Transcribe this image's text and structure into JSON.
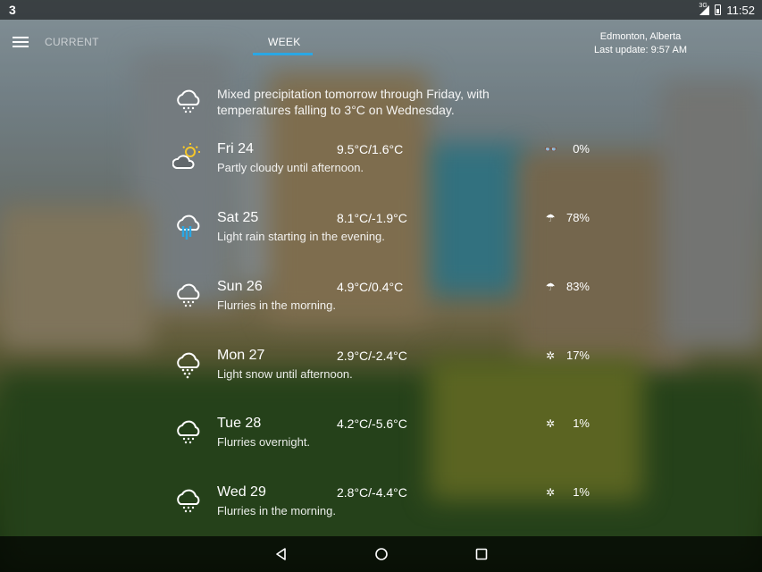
{
  "status_bar": {
    "notification_count": "3",
    "network": "3G",
    "time": "11:52"
  },
  "app_bar": {
    "tabs": [
      {
        "label": "CURRENT",
        "active": false
      },
      {
        "label": "WEEK",
        "active": true
      }
    ],
    "accent_color": "#2aa7e4",
    "location": "Edmonton, Alberta",
    "last_update": "Last update: 9:57 AM"
  },
  "summary": {
    "icon": "flurries-icon",
    "text": "Mixed precipitation tomorrow through Friday, with temperatures falling to 3°C on Wednesday."
  },
  "days": [
    {
      "name": "Fri 24",
      "temp": "9.5°C/1.6°C",
      "desc": "Partly cloudy until afternoon.",
      "icon": "partly-cloudy-icon",
      "precip_icon": "sunglasses-icon",
      "precip_glyph": "👓",
      "pct": "0%"
    },
    {
      "name": "Sat 25",
      "temp": "8.1°C/-1.9°C",
      "desc": "Light rain starting in the evening.",
      "icon": "rain-icon",
      "precip_icon": "umbrella-icon",
      "precip_glyph": "☂",
      "pct": "78%"
    },
    {
      "name": "Sun 26",
      "temp": "4.9°C/0.4°C",
      "desc": "Flurries in the morning.",
      "icon": "flurries-icon",
      "precip_icon": "umbrella-icon",
      "precip_glyph": "☂",
      "pct": "83%"
    },
    {
      "name": "Mon 27",
      "temp": "2.9°C/-2.4°C",
      "desc": "Light snow until afternoon.",
      "icon": "snow-icon",
      "precip_icon": "snowflake-icon",
      "precip_glyph": "✲",
      "pct": "17%"
    },
    {
      "name": "Tue 28",
      "temp": "4.2°C/-5.6°C",
      "desc": "Flurries overnight.",
      "icon": "flurries-icon",
      "precip_icon": "snowflake-icon",
      "precip_glyph": "✲",
      "pct": "1%"
    },
    {
      "name": "Wed 29",
      "temp": "2.8°C/-4.4°C",
      "desc": "Flurries in the morning.",
      "icon": "flurries-icon",
      "precip_icon": "snowflake-icon",
      "precip_glyph": "✲",
      "pct": "1%"
    }
  ],
  "nav": {
    "back_icon": "back-icon",
    "home_icon": "home-icon",
    "recents_icon": "recents-icon"
  }
}
